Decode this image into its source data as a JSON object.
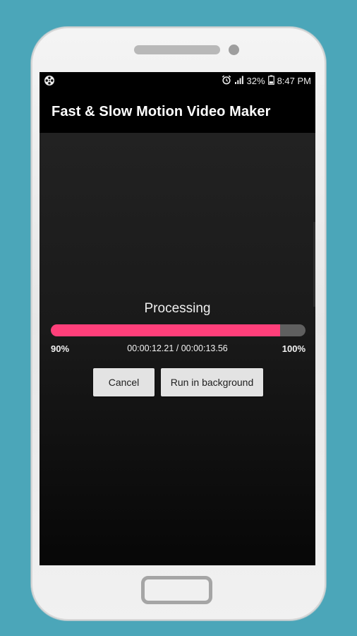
{
  "status_bar": {
    "app_icon": "film-reel-icon",
    "alarm_icon": "alarm-clock-icon",
    "signal_icon": "signal-bars-icon",
    "battery_level": "32%",
    "battery_icon": "battery-icon",
    "time": "8:47 PM"
  },
  "app_bar": {
    "title": "Fast & Slow Motion Video Maker"
  },
  "dialog": {
    "heading": "Processing",
    "progress_fraction": 0.9,
    "progress_start_label": "90%",
    "progress_end_label": "100%",
    "time_label": "00:00:12.21 / 00:00:13.56",
    "accent_color": "#ff3f7a",
    "track_color": "#5f5f5f"
  },
  "buttons": {
    "cancel_label": "Cancel",
    "run_background_label": "Run in background"
  },
  "colors": {
    "background": "#4ba6b9",
    "screen_background": "#000000"
  }
}
